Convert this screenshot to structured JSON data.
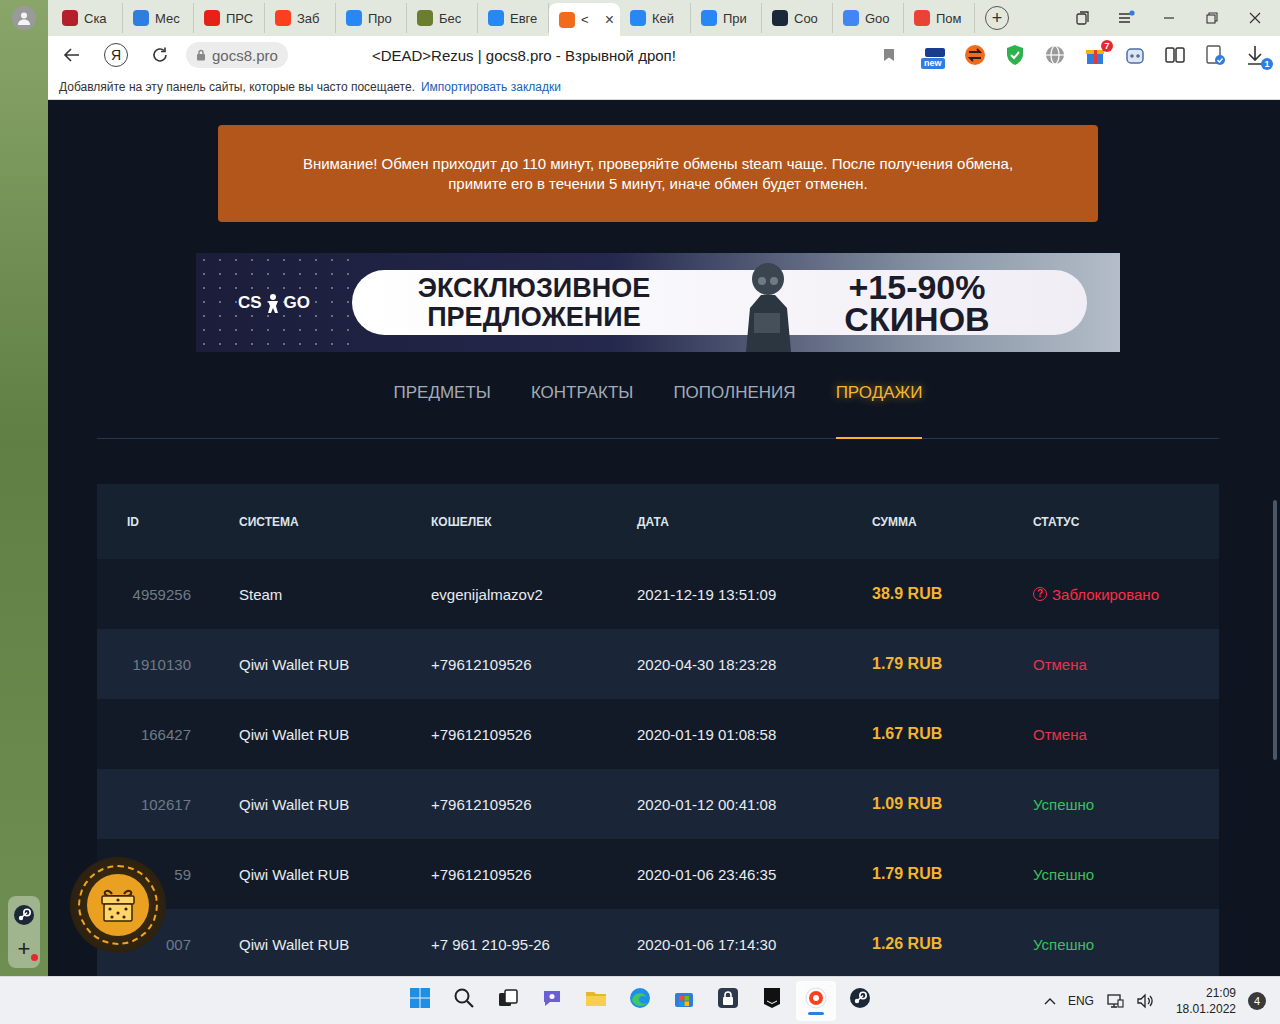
{
  "browser": {
    "tabs": [
      {
        "label": "Ска",
        "selected": false,
        "color": "#b3202a"
      },
      {
        "label": "Мес",
        "selected": false,
        "color": "#2f7de1"
      },
      {
        "label": "ПРС",
        "selected": false,
        "color": "#e62117"
      },
      {
        "label": "Заб",
        "selected": false,
        "color": "#fc3f1d"
      },
      {
        "label": "Про",
        "selected": false,
        "color": "#2787f5"
      },
      {
        "label": "Бес",
        "selected": false,
        "color": "#6b7d2e"
      },
      {
        "label": "Евге",
        "selected": false,
        "color": "#2787f5"
      },
      {
        "label": "<",
        "selected": true,
        "color": "#f26b1d",
        "close": "×"
      },
      {
        "label": "Кей",
        "selected": false,
        "color": "#2787f5"
      },
      {
        "label": "При",
        "selected": false,
        "color": "#2787f5"
      },
      {
        "label": "Соо",
        "selected": false,
        "color": "#1b2838"
      },
      {
        "label": "Goo",
        "selected": false,
        "color": "#4285f4"
      },
      {
        "label": "Пом",
        "selected": false,
        "color": "#ea4335"
      }
    ],
    "new_tab": "+",
    "address": {
      "yandex": "Я",
      "host": "gocs8.pro",
      "title": "<DEAD>Rezus | gocs8.pro - Взрывной дроп!"
    },
    "toolbar_badges": {
      "new": "new",
      "gift": "7",
      "downloads": "1"
    },
    "bookmarks_bar": {
      "hint": "Добавляйте на эту панель сайты, которые вы часто посещаете.",
      "link": "Импортировать закладки"
    },
    "sidebar_add": "+"
  },
  "page": {
    "notice": [
      "Внимание! Обмен приходит до 110 минут, проверяйте обмены steam чаще. После получения обмена,",
      "примите его в течении 5 минут, иначе обмен будет отменен."
    ],
    "banner": {
      "logo": [
        "CS",
        "GO"
      ],
      "headline": [
        "ЭКСКЛЮЗИВНОЕ",
        "ПРЕДЛОЖЕНИЕ"
      ],
      "offer": [
        "+15-90%",
        "СКИНОВ"
      ]
    },
    "nav": [
      {
        "label": "ПРЕДМЕТЫ",
        "selected": false
      },
      {
        "label": "КОНТРАКТЫ",
        "selected": false
      },
      {
        "label": "ПОПОЛНЕНИЯ",
        "selected": false
      },
      {
        "label": "ПРОДАЖИ",
        "selected": true
      }
    ],
    "table": {
      "columns": [
        "ID",
        "СИСТЕМА",
        "КОШЕЛЕК",
        "ДАТА",
        "СУММА",
        "СТАТУС"
      ],
      "rows": [
        {
          "id": "4959256",
          "system": "Steam",
          "wallet": "evgenijalmazov2",
          "date": "2021-12-19 13:51:09",
          "sum": "38.9 RUB",
          "status": "Заблокировано",
          "status_icon": "?",
          "color": "#ff2b45"
        },
        {
          "id": "1910130",
          "system": "Qiwi Wallet RUB",
          "wallet": "+79612109526",
          "date": "2020-04-30 18:23:28",
          "sum": "1.79 RUB",
          "status": "Отмена",
          "color": "#e8334a"
        },
        {
          "id": "166427",
          "system": "Qiwi Wallet RUB",
          "wallet": "+79612109526",
          "date": "2020-01-19 01:08:58",
          "sum": "1.67 RUB",
          "status": "Отмена",
          "color": "#e8334a"
        },
        {
          "id": "102617",
          "system": "Qiwi Wallet RUB",
          "wallet": "+79612109526",
          "date": "2020-01-12 00:41:08",
          "sum": "1.09 RUB",
          "status": "Успешно",
          "color": "#3cc05a"
        },
        {
          "id": "59",
          "system": "Qiwi Wallet RUB",
          "wallet": "+79612109526",
          "date": "2020-01-06 23:46:35",
          "sum": "1.79 RUB",
          "status": "Успешно",
          "color": "#3cc05a"
        },
        {
          "id": "007",
          "system": "Qiwi Wallet RUB",
          "wallet": "+7 961 210-95-26",
          "date": "2020-01-06 17:14:30",
          "sum": "1.26 RUB",
          "status": "Успешно",
          "color": "#3cc05a"
        }
      ]
    }
  },
  "taskbar": {
    "apps": [
      {
        "selected": false
      },
      {
        "selected": false
      },
      {
        "selected": false
      },
      {
        "selected": false
      },
      {
        "selected": false
      },
      {
        "selected": false
      },
      {
        "selected": false
      },
      {
        "selected": false
      },
      {
        "selected": false
      },
      {
        "selected": true
      },
      {
        "selected": false
      }
    ],
    "language": "ENG",
    "time": "21:09",
    "date": "18.01.2022",
    "notifications": "4"
  }
}
